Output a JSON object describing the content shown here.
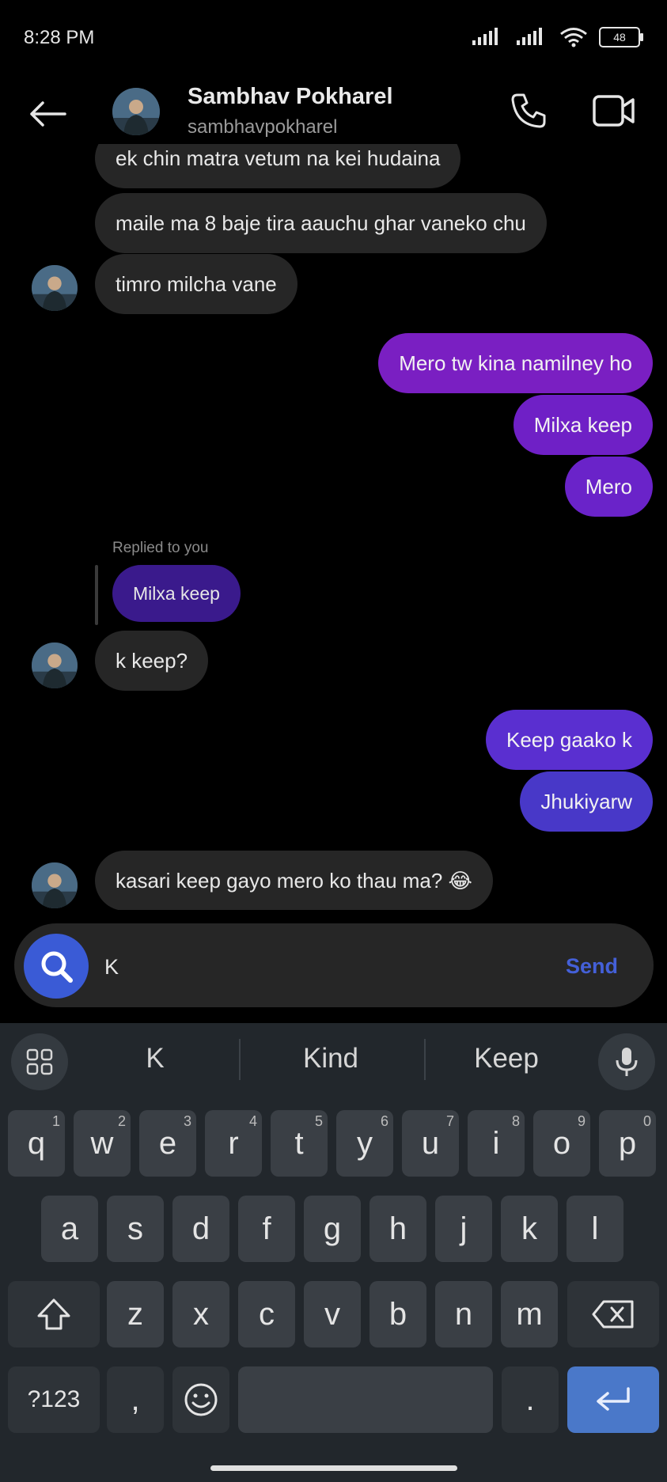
{
  "status_bar": {
    "time": "8:28 PM",
    "battery": "48"
  },
  "header": {
    "name": "Sambhav Pokharel",
    "handle": "sambhavpokharel"
  },
  "messages": [
    {
      "dir": "in",
      "text": "ek chin matra vetum na kei hudaina"
    },
    {
      "dir": "in",
      "text": "maile ma 8 baje tira aauchu ghar vaneko chu"
    },
    {
      "dir": "in",
      "text": "timro milcha vane"
    },
    {
      "dir": "out",
      "text": "Mero tw kina namilney ho"
    },
    {
      "dir": "out",
      "text": "Milxa keep"
    },
    {
      "dir": "out",
      "text": "Mero"
    },
    {
      "dir": "reply",
      "label": "Replied to you",
      "text": "Milxa keep"
    },
    {
      "dir": "in",
      "text": "k keep?"
    },
    {
      "dir": "out",
      "text": "Keep gaako k"
    },
    {
      "dir": "out",
      "text": "Jhukiyarw"
    },
    {
      "dir": "in",
      "text": "kasari keep gayo mero ko thau ma? 😂"
    }
  ],
  "composer": {
    "value": "K",
    "send_label": "Send"
  },
  "keyboard": {
    "suggestions": [
      "K",
      "Kind",
      "Keep"
    ],
    "row1": [
      {
        "k": "q",
        "h": "1"
      },
      {
        "k": "w",
        "h": "2"
      },
      {
        "k": "e",
        "h": "3"
      },
      {
        "k": "r",
        "h": "4"
      },
      {
        "k": "t",
        "h": "5"
      },
      {
        "k": "y",
        "h": "6"
      },
      {
        "k": "u",
        "h": "7"
      },
      {
        "k": "i",
        "h": "8"
      },
      {
        "k": "o",
        "h": "9"
      },
      {
        "k": "p",
        "h": "0"
      }
    ],
    "row2": [
      "a",
      "s",
      "d",
      "f",
      "g",
      "h",
      "j",
      "k",
      "l"
    ],
    "row3": [
      "z",
      "x",
      "c",
      "v",
      "b",
      "n",
      "m"
    ],
    "symbols_label": "?123",
    "comma": ",",
    "period": "."
  },
  "colors": {
    "bubble_in": "#262626",
    "bubble_out_1": "#7a1fc2",
    "bubble_out_2": "#6a23c9",
    "bubble_out_3": "#5a2fd0",
    "bubble_out_4": "#4838c8",
    "accent": "#3a5bd6"
  },
  "icons": [
    "back-arrow-icon",
    "phone-icon",
    "video-camera-icon",
    "search-icon",
    "apps-grid-icon",
    "microphone-icon",
    "shift-icon",
    "backspace-icon",
    "emoji-icon",
    "enter-icon",
    "signal-icon",
    "wifi-icon"
  ]
}
